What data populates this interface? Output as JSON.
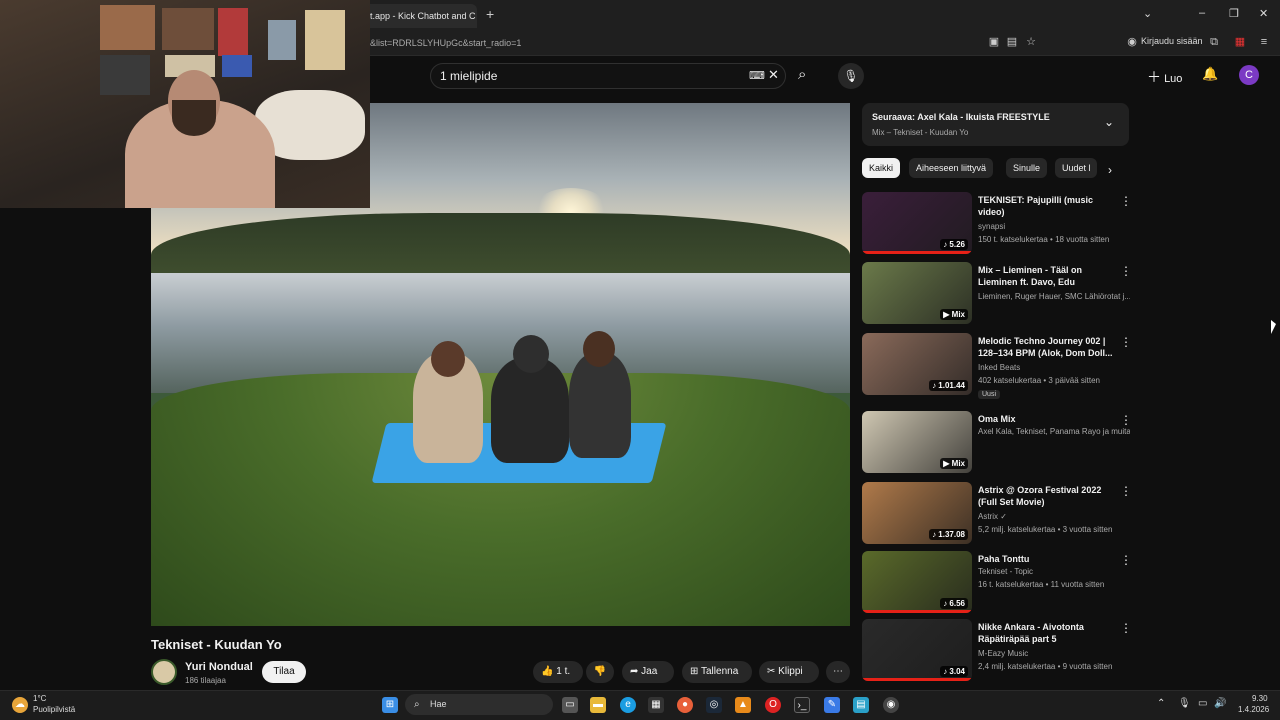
{
  "browser": {
    "tab_title": "t.app - Kick Chatbot and C",
    "new_tab": "+",
    "url": "&list=RDRLSLYHUpGc&start_radio=1",
    "signin": "Kirjaudu sisään"
  },
  "header": {
    "search_value": "1 mielipide",
    "create_label": "Luo",
    "avatar_letter": "C"
  },
  "video": {
    "title": "Tekniset - Kuudan Yo",
    "channel": "Yuri Nondual",
    "subscribers": "186 tilaajaa",
    "subscribe_label": "Tilaa",
    "like_count": "1 t.",
    "share_label": "Jaa",
    "save_label": "Tallenna",
    "clip_label": "Klippi"
  },
  "upnext": {
    "title": "Seuraava: Axel Kala - Ikuista FREESTYLE",
    "subtitle": "Mix – Tekniset - Kuudan Yo"
  },
  "chips": [
    "Kaikki",
    "Aiheeseen liittyvä",
    "Sinulle",
    "Uudet l"
  ],
  "recommendations": [
    {
      "title": "TEKNISET: Pajupilli (music video)",
      "channel": "synapsi",
      "meta": "150 t. katselukertaa • 18 vuotta sitten",
      "badge": "5.26",
      "progress": 1.0,
      "color": "#3a1e3a"
    },
    {
      "title": "Mix – Lieminen - Tääl on Lieminen ft. Davo, Edu",
      "channel": "Lieminen, Ruger Hauer, SMC Lähiörotat j...",
      "meta": "",
      "badge": "Mix",
      "progress": 0,
      "color": "#6b7a4a"
    },
    {
      "title": "Melodic Techno Journey 002 | 128–134 BPM (Alok, Dom Doll...",
      "channel": "Inked Beats",
      "meta": "402 katselukertaa • 3 päivää sitten",
      "badge": "1.01.44",
      "new": "Uusi",
      "progress": 0,
      "color": "#8a6a5a"
    },
    {
      "title": "Oma Mix",
      "channel": "Axel Kala, Tekniset, Panama Rayo ja muita",
      "meta": "",
      "badge": "Mix",
      "progress": 0,
      "color": "#cfc7b2"
    },
    {
      "title": "Astrix @ Ozora Festival 2022 (Full Set Movie)",
      "channel": "Astrix ✓",
      "meta": "5,2 milj. katselukertaa • 3 vuotta sitten",
      "badge": "1.37.08",
      "progress": 0,
      "color": "#b07a4a"
    },
    {
      "title": "Paha Tonttu",
      "channel": "Tekniset - Topic",
      "meta": "16 t. katselukertaa • 11 vuotta sitten",
      "badge": "6.56",
      "progress": 1.0,
      "color": "#5a6a2a"
    },
    {
      "title": "Nikke Ankara - Aivotonta Räpätiräpää part 5",
      "channel": "M-Eazy Music",
      "meta": "2,4 milj. katselukertaa • 9 vuotta sitten",
      "badge": "3.04",
      "progress": 1.0,
      "color": "#2a2a2a"
    }
  ],
  "taskbar": {
    "weather_temp": "1°C",
    "weather_desc": "Puolipilvistä",
    "search_label": "Hae",
    "time": "9.30",
    "date": "1.4.2026"
  }
}
